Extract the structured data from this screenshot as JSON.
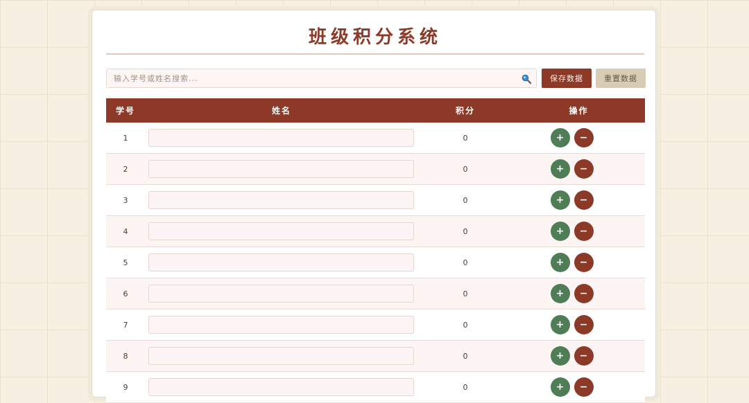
{
  "app": {
    "title": "班级积分系统"
  },
  "toolbar": {
    "search_placeholder": "输入学号或姓名搜索...",
    "save_label": "保存数据",
    "reset_label": "重置数据",
    "search_icon": "search-icon"
  },
  "table": {
    "headers": {
      "id": "学号",
      "name": "姓名",
      "score": "积分",
      "ops": "操作"
    },
    "plus_label": "+",
    "minus_label": "−",
    "rows": [
      {
        "id": "1",
        "name": "",
        "score": "0"
      },
      {
        "id": "2",
        "name": "",
        "score": "0"
      },
      {
        "id": "3",
        "name": "",
        "score": "0"
      },
      {
        "id": "4",
        "name": "",
        "score": "0"
      },
      {
        "id": "5",
        "name": "",
        "score": "0"
      },
      {
        "id": "6",
        "name": "",
        "score": "0"
      },
      {
        "id": "7",
        "name": "",
        "score": "0"
      },
      {
        "id": "8",
        "name": "",
        "score": "0"
      },
      {
        "id": "9",
        "name": "",
        "score": "0"
      }
    ]
  },
  "colors": {
    "primary": "#8c3a27",
    "plus": "#4e7d56",
    "reset": "#d8ccb5",
    "background": "#f7f0e2"
  }
}
